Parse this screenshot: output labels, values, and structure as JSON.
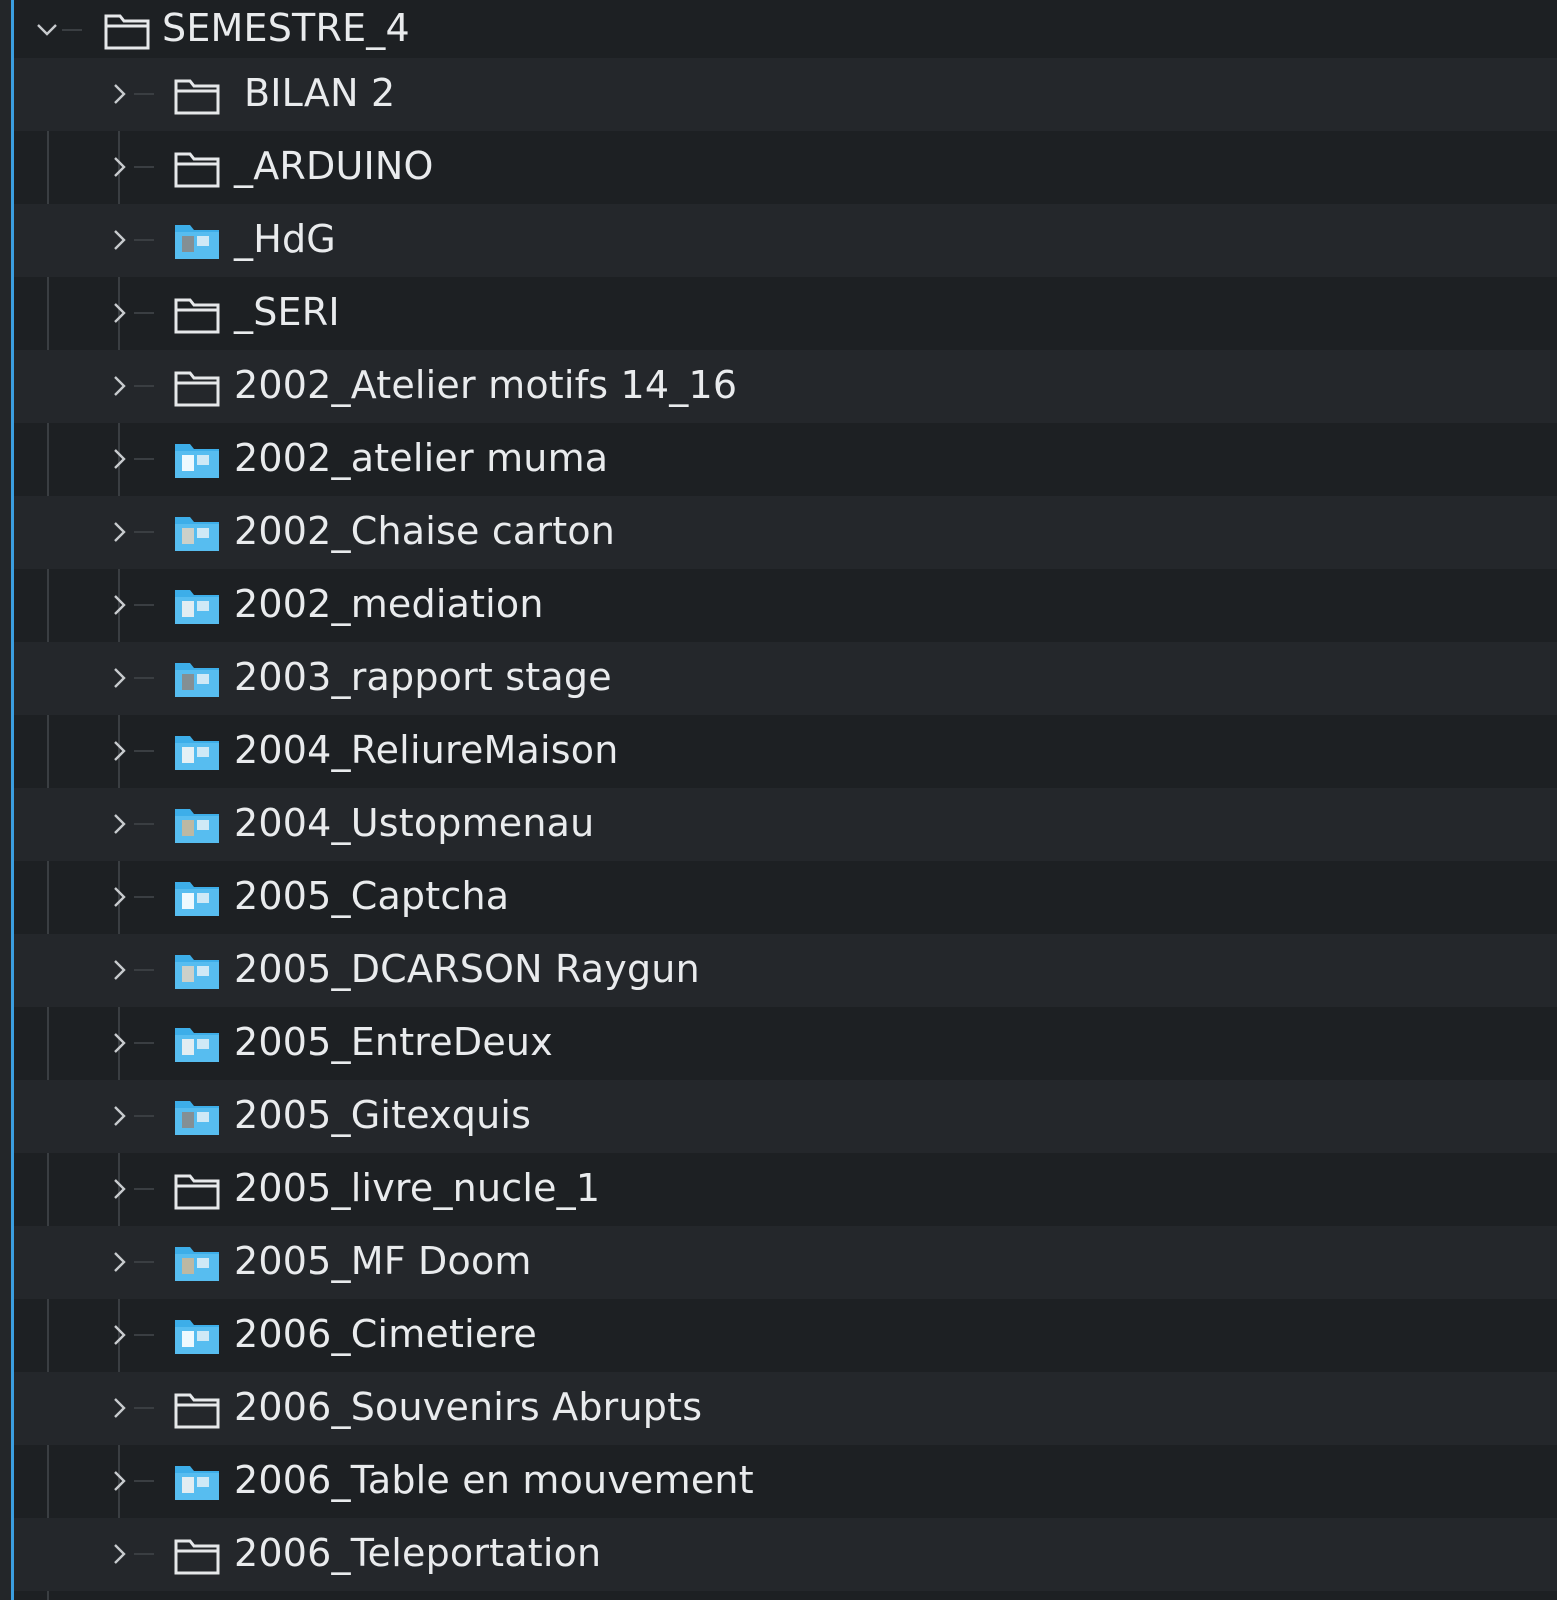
{
  "root": {
    "label": "SEMESTRE_4",
    "icon": "folder-outline-icon",
    "expanded": true
  },
  "children": [
    {
      "label": "BILAN 2",
      "icon": "folder-outline-icon"
    },
    {
      "label": "_ARDUINO",
      "icon": "folder-outline-icon"
    },
    {
      "label": "_HdG",
      "icon": "folder-blue-thumbnail-icon"
    },
    {
      "label": "_SERI",
      "icon": "folder-outline-icon"
    },
    {
      "label": "2002_Atelier motifs 14_16",
      "icon": "folder-outline-icon"
    },
    {
      "label": "2002_atelier muma",
      "icon": "folder-blue-thumbnail-icon"
    },
    {
      "label": "2002_Chaise carton",
      "icon": "folder-blue-thumbnail-icon"
    },
    {
      "label": "2002_mediation",
      "icon": "folder-blue-thumbnail-icon"
    },
    {
      "label": "2003_rapport stage",
      "icon": "folder-blue-thumbnail-icon"
    },
    {
      "label": "2004_ReliureMaison",
      "icon": "folder-blue-thumbnail-icon"
    },
    {
      "label": "2004_Ustopmenau",
      "icon": "folder-blue-thumbnail-icon"
    },
    {
      "label": "2005_Captcha",
      "icon": "folder-blue-thumbnail-icon"
    },
    {
      "label": "2005_DCARSON Raygun",
      "icon": "folder-blue-thumbnail-icon"
    },
    {
      "label": "2005_EntreDeux",
      "icon": "folder-blue-thumbnail-icon"
    },
    {
      "label": "2005_Gitexquis",
      "icon": "folder-blue-thumbnail-icon"
    },
    {
      "label": "2005_livre_nucle_1",
      "icon": "folder-outline-icon"
    },
    {
      "label": "2005_MF Doom",
      "icon": "folder-blue-thumbnail-icon"
    },
    {
      "label": "2006_Cimetiere",
      "icon": "folder-blue-thumbnail-icon"
    },
    {
      "label": "2006_Souvenirs Abrupts",
      "icon": "folder-outline-icon"
    },
    {
      "label": "2006_Table en mouvement",
      "icon": "folder-blue-thumbnail-icon"
    },
    {
      "label": "2006_Teleportation",
      "icon": "folder-outline-icon"
    }
  ],
  "colors": {
    "background": "#1d2023",
    "row_alt": "#24272b",
    "accent": "#3b9ee0",
    "folder_blue": "#3daee9",
    "text": "#e9ebed"
  }
}
